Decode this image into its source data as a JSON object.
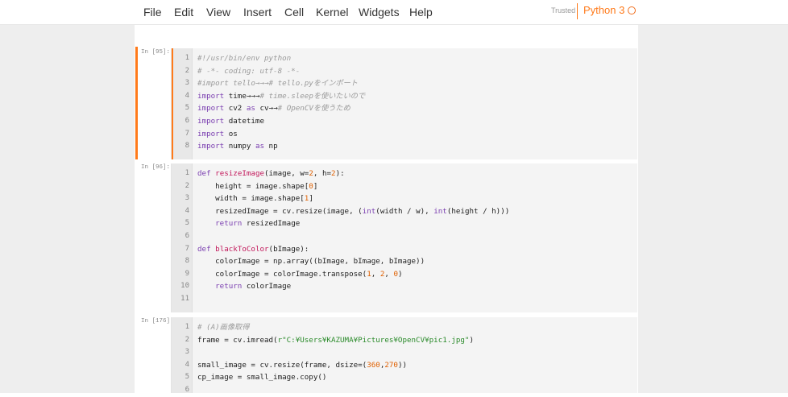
{
  "menubar": {
    "items": [
      "File",
      "Edit",
      "View",
      "Insert",
      "Cell",
      "Kernel",
      "Widgets",
      "Help"
    ],
    "trusted": "Trusted",
    "kernel": "Python 3"
  },
  "colors": {
    "accent": "#ff7a1a",
    "keyword": "#7a3eb0",
    "comment": "#9a9a9a",
    "number": "#e06000",
    "string": "#2a8a2a",
    "function": "#c2185b"
  },
  "cells": [
    {
      "prompt": "In [95]:",
      "lines": [
        {
          "n": "1",
          "t": [
            [
              "#!/usr/bin/env python",
              "cm"
            ]
          ]
        },
        {
          "n": "2",
          "t": [
            [
              "# -*- coding: utf-8 -*-",
              "cm"
            ]
          ]
        },
        {
          "n": "3",
          "t": [
            [
              "#import tello→→→# tello.pyをインポート",
              "cm"
            ]
          ]
        },
        {
          "n": "4",
          "t": [
            [
              "import",
              "kw"
            ],
            [
              " time→→→",
              ""
            ],
            [
              "# time.sleepを使いたいので",
              "cm"
            ]
          ]
        },
        {
          "n": "5",
          "t": [
            [
              "import",
              "kw"
            ],
            [
              " cv2 ",
              ""
            ],
            [
              "as",
              "kw"
            ],
            [
              " cv→→",
              ""
            ],
            [
              "# OpenCVを使うため",
              "cm"
            ]
          ]
        },
        {
          "n": "6",
          "t": [
            [
              "import",
              "kw"
            ],
            [
              " datetime",
              ""
            ]
          ]
        },
        {
          "n": "7",
          "t": [
            [
              "import",
              "kw"
            ],
            [
              " os",
              ""
            ]
          ]
        },
        {
          "n": "8",
          "t": [
            [
              "import",
              "kw"
            ],
            [
              " numpy ",
              ""
            ],
            [
              "as",
              "kw"
            ],
            [
              " np",
              ""
            ]
          ]
        }
      ]
    },
    {
      "prompt": "In [96]:",
      "lines": [
        {
          "n": "1",
          "t": [
            [
              "def",
              "kw"
            ],
            [
              " ",
              ""
            ],
            [
              "resizeImage",
              "fn"
            ],
            [
              "(image, w=",
              ""
            ],
            [
              "2",
              "num"
            ],
            [
              ", h=",
              ""
            ],
            [
              "2",
              "num"
            ],
            [
              "):",
              ""
            ]
          ]
        },
        {
          "n": "2",
          "t": [
            [
              "    height = image.shape[",
              ""
            ],
            [
              "0",
              "num"
            ],
            [
              "]",
              ""
            ]
          ]
        },
        {
          "n": "3",
          "t": [
            [
              "    width = image.shape[",
              ""
            ],
            [
              "1",
              "num"
            ],
            [
              "]",
              ""
            ]
          ]
        },
        {
          "n": "4",
          "t": [
            [
              "    resizedImage = cv.resize(image, (",
              ""
            ],
            [
              "int",
              "kw"
            ],
            [
              "(width / w), ",
              ""
            ],
            [
              "int",
              "kw"
            ],
            [
              "(height / h)))",
              ""
            ]
          ]
        },
        {
          "n": "5",
          "t": [
            [
              "    ",
              ""
            ],
            [
              "return",
              "kw"
            ],
            [
              " resizedImage",
              ""
            ]
          ]
        },
        {
          "n": "6",
          "t": [
            [
              "",
              ""
            ]
          ]
        },
        {
          "n": "7",
          "t": [
            [
              "def",
              "kw"
            ],
            [
              " ",
              ""
            ],
            [
              "blackToColor",
              "fn"
            ],
            [
              "(bImage):",
              ""
            ]
          ]
        },
        {
          "n": "8",
          "t": [
            [
              "    colorImage = np.array((bImage, bImage, bImage))",
              ""
            ]
          ]
        },
        {
          "n": "9",
          "t": [
            [
              "    colorImage = colorImage.transpose(",
              ""
            ],
            [
              "1",
              "num"
            ],
            [
              ", ",
              ""
            ],
            [
              "2",
              "num"
            ],
            [
              ", ",
              ""
            ],
            [
              "0",
              "num"
            ],
            [
              ")",
              ""
            ]
          ]
        },
        {
          "n": "10",
          "t": [
            [
              "    ",
              ""
            ],
            [
              "return",
              "kw"
            ],
            [
              " colorImage",
              ""
            ]
          ]
        },
        {
          "n": "11",
          "t": [
            [
              "",
              ""
            ]
          ]
        }
      ]
    },
    {
      "prompt": "In [176]:",
      "lines": [
        {
          "n": "1",
          "t": [
            [
              "# (A)画像取得",
              "cm"
            ]
          ]
        },
        {
          "n": "2",
          "t": [
            [
              "frame = cv.imread(",
              ""
            ],
            [
              "r\"C:¥Users¥KAZUMA¥Pictures¥OpenCV¥pic1.jpg\"",
              "str"
            ],
            [
              ")",
              ""
            ]
          ]
        },
        {
          "n": "3",
          "t": [
            [
              "",
              ""
            ]
          ]
        },
        {
          "n": "4",
          "t": [
            [
              "small_image = cv.resize(frame, dsize=(",
              ""
            ],
            [
              "360",
              "num"
            ],
            [
              ",",
              ""
            ],
            [
              "270",
              "num"
            ],
            [
              "))",
              ""
            ]
          ]
        },
        {
          "n": "5",
          "t": [
            [
              "cp_image = small_image.copy()",
              ""
            ]
          ]
        },
        {
          "n": "6",
          "t": [
            [
              "",
              ""
            ]
          ]
        }
      ]
    }
  ]
}
